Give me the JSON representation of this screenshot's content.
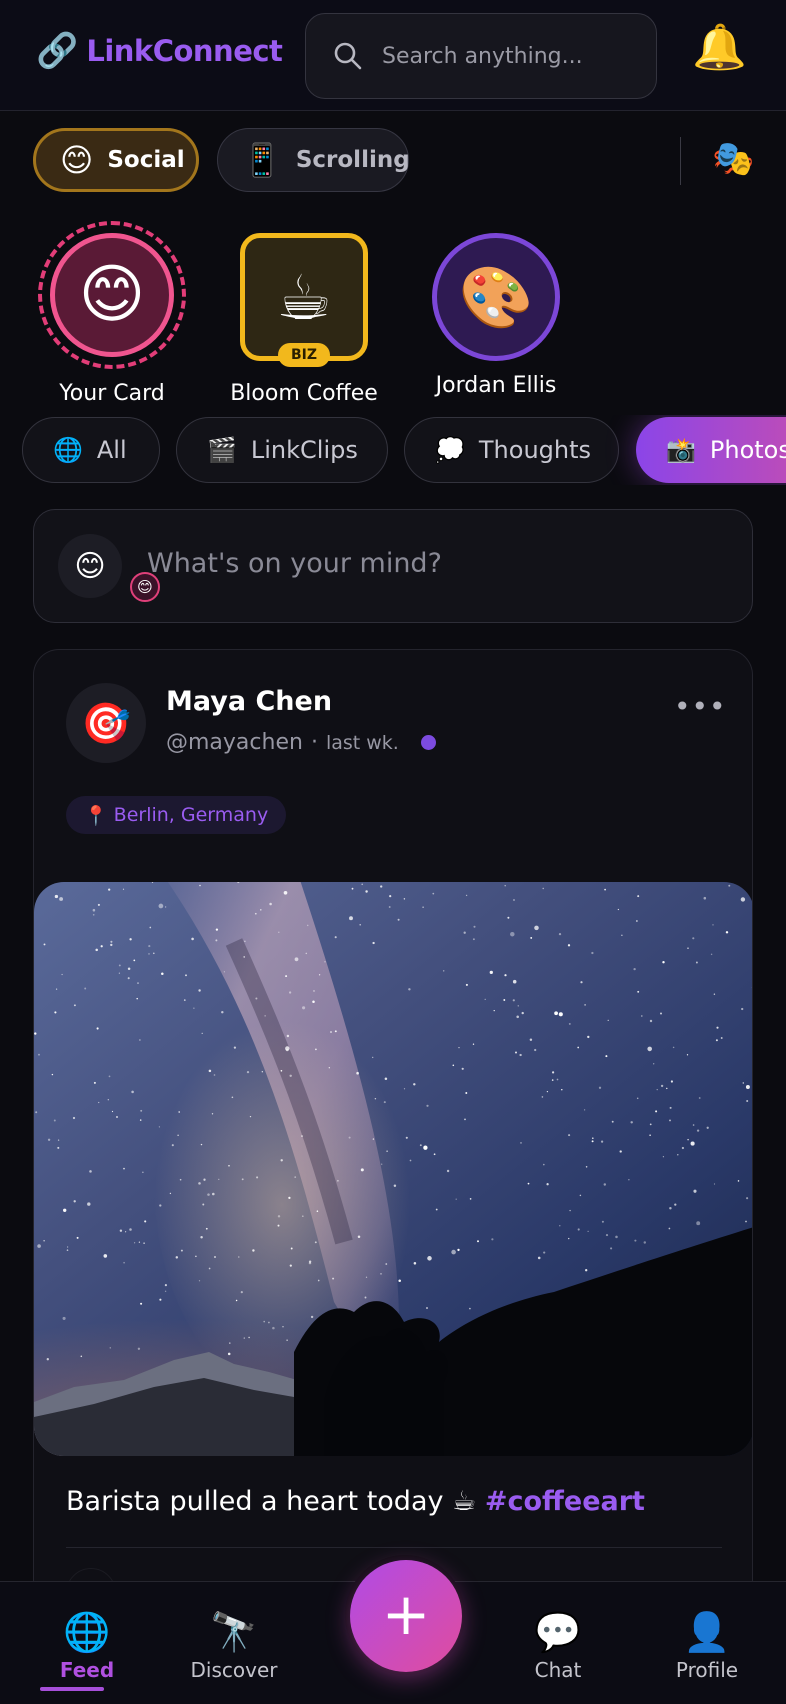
{
  "header": {
    "logo_icon": "🔗",
    "logo_text": "LinkConnect",
    "search_placeholder": "Search anything...",
    "bell_icon": "🔔"
  },
  "modes": {
    "social": {
      "emoji": "😊",
      "label": "Social"
    },
    "scrolling": {
      "emoji": "📱",
      "label": "Scrolling"
    },
    "theater_icon": "🎭"
  },
  "stories": [
    {
      "emoji": "😊",
      "label": "Your Card"
    },
    {
      "emoji": "☕",
      "label": "Bloom Coffee",
      "badge": "BIZ"
    },
    {
      "emoji": "🎨",
      "label": "Jordan Ellis"
    }
  ],
  "filters": [
    {
      "emoji": "🌐",
      "label": "All"
    },
    {
      "emoji": "🎬",
      "label": "LinkClips"
    },
    {
      "emoji": "💭",
      "label": "Thoughts"
    },
    {
      "emoji": "📸",
      "label": "Photos"
    }
  ],
  "composer": {
    "avatar": "😊",
    "mini_avatar": "😊",
    "placeholder": "What's on your mind?"
  },
  "post": {
    "avatar": "🎯",
    "author": "Maya Chen",
    "handle": "@mayachen",
    "separator": "·",
    "time": "last wk.",
    "more": "•••",
    "location_pin": "📍",
    "location": "Berlin, Germany",
    "caption": "Barista pulled a heart today ☕ ",
    "hashtag": "#coffeeart"
  },
  "nav": {
    "feed": {
      "icon": "🌐",
      "label": "Feed"
    },
    "discover": {
      "icon": "🔭",
      "label": "Discover"
    },
    "create": "+",
    "chat": {
      "icon": "💬",
      "label": "Chat"
    },
    "profile": {
      "icon": "👤",
      "label": "Profile"
    }
  },
  "colors": {
    "accent": "#9a5cf0",
    "pink": "#e0407a",
    "gold": "#f2b81c",
    "background": "#0b0b10"
  }
}
